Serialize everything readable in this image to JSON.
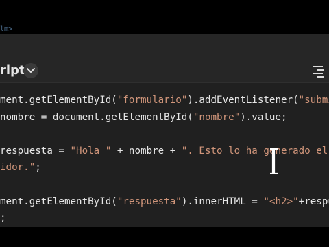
{
  "top_strip_text": "lm>",
  "editor": {
    "language_label": "ript",
    "chevron_icon": "chevron-down-icon",
    "format_icon": "format-lines-icon"
  },
  "code_lines": [
    [
      {
        "t": "ment.getElementById(",
        "c": "p"
      },
      {
        "t": "\"formulario\"",
        "c": "s"
      },
      {
        "t": ").addEventListener(",
        "c": "p"
      },
      {
        "t": "\"submit",
        "c": "s"
      }
    ],
    [
      {
        "t": "nombre = document.getElementById(",
        "c": "p"
      },
      {
        "t": "\"nombre\"",
        "c": "s"
      },
      {
        "t": ").value;",
        "c": "p"
      }
    ],
    [],
    [
      {
        "t": "respuesta = ",
        "c": "p"
      },
      {
        "t": "\"Hola \"",
        "c": "s"
      },
      {
        "t": " + nombre + ",
        "c": "p"
      },
      {
        "t": "\". Esto lo ha generado el",
        "c": "s"
      }
    ],
    [
      {
        "t": "idor.\"",
        "c": "s"
      },
      {
        "t": ";",
        "c": "p"
      }
    ],
    [],
    [
      {
        "t": "ment.getElementById(",
        "c": "p"
      },
      {
        "t": "\"respuesta\"",
        "c": "s"
      },
      {
        "t": ").innerHTML = ",
        "c": "p"
      },
      {
        "t": "\"<h2>\"",
        "c": "s"
      },
      {
        "t": "+respue",
        "c": "p"
      }
    ],
    [
      {
        "t": ";",
        "c": "p"
      }
    ]
  ],
  "colors": {
    "background": "#202020",
    "header": "#262626",
    "string": "#d0957a",
    "text": "#e6e6e6"
  }
}
